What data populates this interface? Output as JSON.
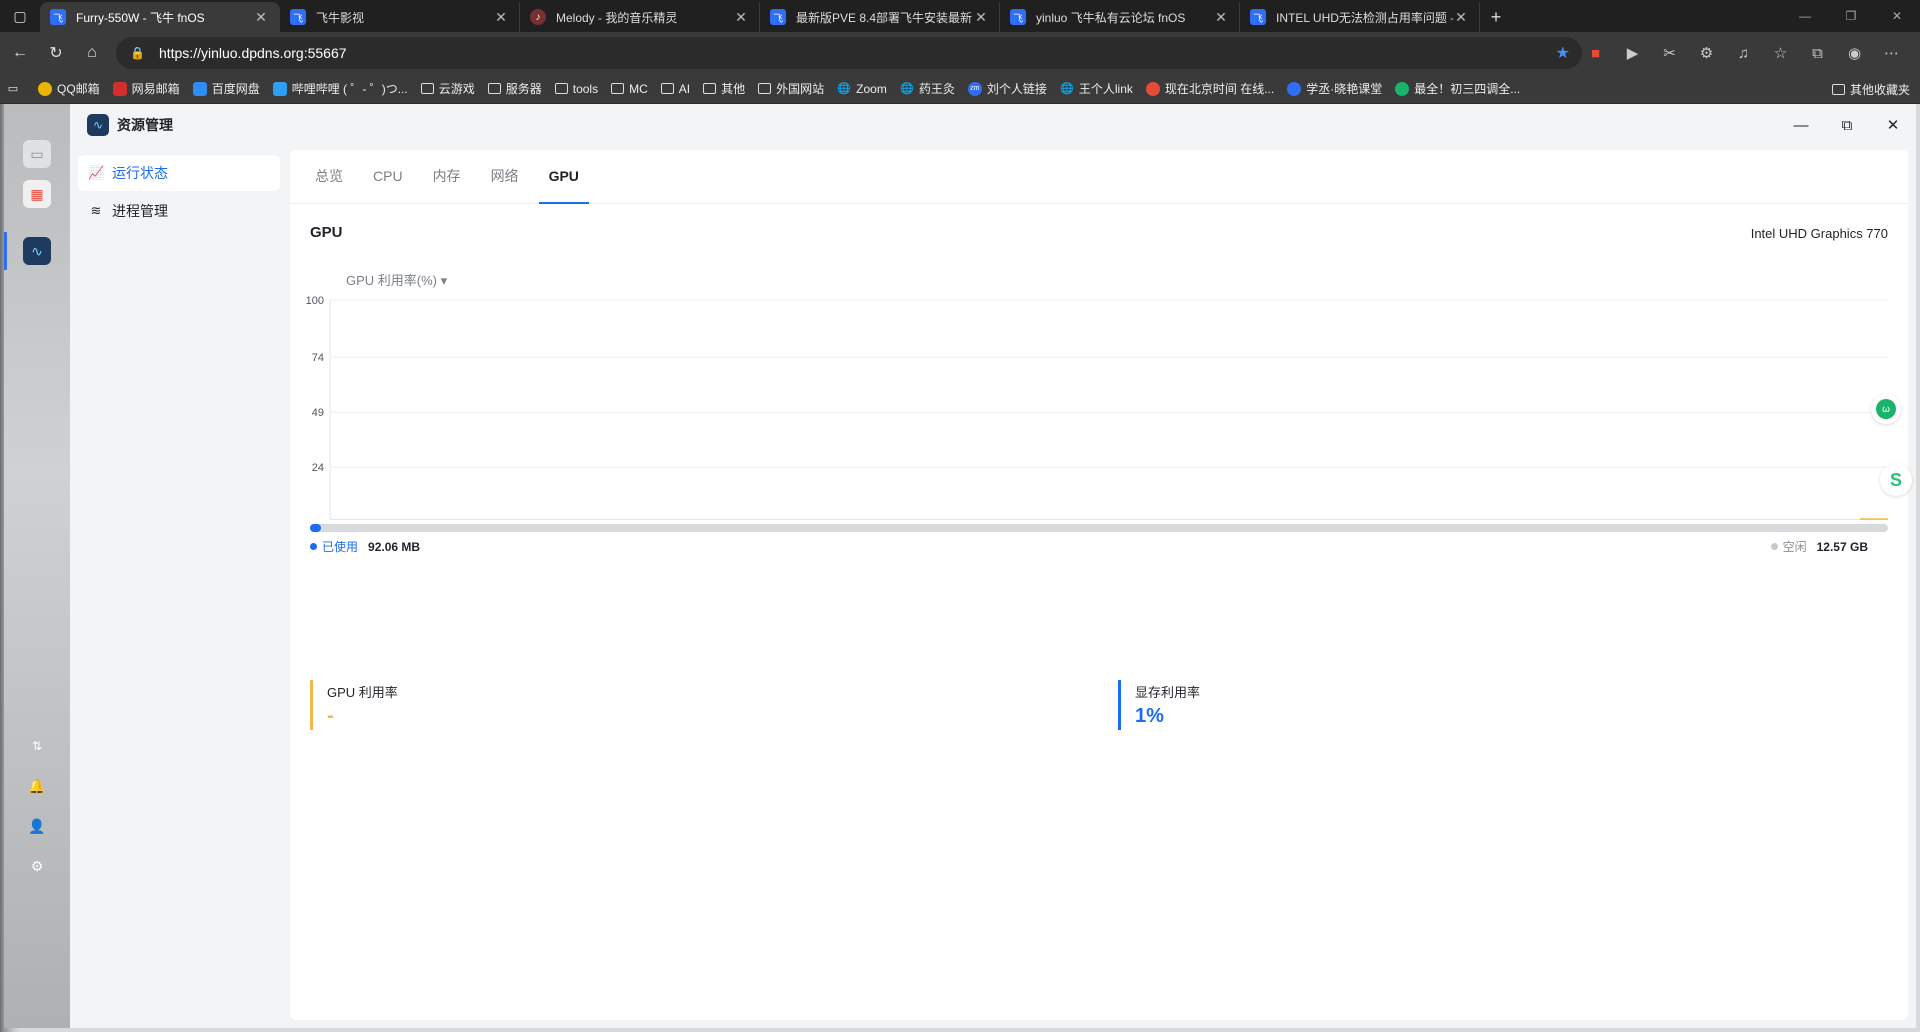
{
  "browser": {
    "tabs": [
      {
        "title": "Furry-550W - 飞牛 fnOS",
        "active": true
      },
      {
        "title": "飞牛影视",
        "active": false
      },
      {
        "title": "Melody - 我的音乐精灵",
        "active": false
      },
      {
        "title": "最新版PVE 8.4部署飞牛安装最新...",
        "active": false
      },
      {
        "title": "yinluo 飞牛私有云论坛 fnOS",
        "active": false
      },
      {
        "title": "INTEL UHD无法检测占用率问题 -",
        "active": false
      }
    ],
    "url": "https://yinluo.dpdns.org:55667",
    "bookmarks": [
      {
        "label": "QQ邮箱",
        "icon": "qq-mail-icon",
        "color": "#e8b500"
      },
      {
        "label": "网易邮箱",
        "icon": "netease-mail-icon",
        "color": "#d32f2f"
      },
      {
        "label": "百度网盘",
        "icon": "baidu-pan-icon",
        "color": "#2f8cf5"
      },
      {
        "label": "哔哩哔哩 ( ゜- ゜)つ...",
        "icon": "bilibili-icon",
        "color": "#2f9ff5"
      },
      {
        "label": "云游戏",
        "icon": "folder-icon"
      },
      {
        "label": "服务器",
        "icon": "folder-icon"
      },
      {
        "label": "tools",
        "icon": "folder-icon"
      },
      {
        "label": "MC",
        "icon": "folder-icon"
      },
      {
        "label": "AI",
        "icon": "folder-icon"
      },
      {
        "label": "其他",
        "icon": "folder-icon"
      },
      {
        "label": "外国网站",
        "icon": "folder-icon"
      },
      {
        "label": "Zoom",
        "icon": "globe-icon"
      },
      {
        "label": "药王灸",
        "icon": "globe-icon"
      },
      {
        "label": "刘个人链接",
        "icon": "zm-icon",
        "color": "#2f6ef5"
      },
      {
        "label": "王个人link",
        "icon": "globe-icon"
      },
      {
        "label": "现在北京时间 在线...",
        "icon": "clock-icon",
        "color": "#e64a3a"
      },
      {
        "label": "学丞·晓艳课堂",
        "icon": "school-icon",
        "color": "#2f6ef5"
      },
      {
        "label": "最全！初三四调全...",
        "icon": "wechat-icon",
        "color": "#1ab36a"
      }
    ],
    "other_bookmarks": "其他收藏夹"
  },
  "app": {
    "title": "资源管理",
    "nav": [
      {
        "label": "运行状态",
        "icon": "chart-line-icon",
        "active": true
      },
      {
        "label": "进程管理",
        "icon": "layers-icon",
        "active": false
      }
    ],
    "tabs": [
      {
        "label": "总览",
        "active": false
      },
      {
        "label": "CPU",
        "active": false
      },
      {
        "label": "内存",
        "active": false
      },
      {
        "label": "网络",
        "active": false
      },
      {
        "label": "GPU",
        "active": true
      }
    ],
    "gpu": {
      "heading": "GPU",
      "model": "Intel UHD Graphics 770",
      "metric_selector": "GPU 利用率(%)",
      "memory": {
        "used_label": "已使用",
        "used_value": "92.06 MB",
        "free_label": "空闲",
        "free_value": "12.57 GB",
        "used_fraction": 0.007
      },
      "stats": [
        {
          "label": "GPU 利用率",
          "value": "-",
          "color": "#f0b84a"
        },
        {
          "label": "显存利用率",
          "value": "1%",
          "color": "#1a6df0"
        }
      ]
    }
  },
  "chart_data": {
    "type": "line",
    "title": "",
    "ylabel": "GPU 利用率(%)",
    "yticks": [
      100,
      74,
      49,
      24
    ],
    "ylim": [
      0,
      100
    ],
    "series": [
      {
        "values": [
          0
        ],
        "color": "#f0b84a"
      }
    ],
    "grid": true
  }
}
